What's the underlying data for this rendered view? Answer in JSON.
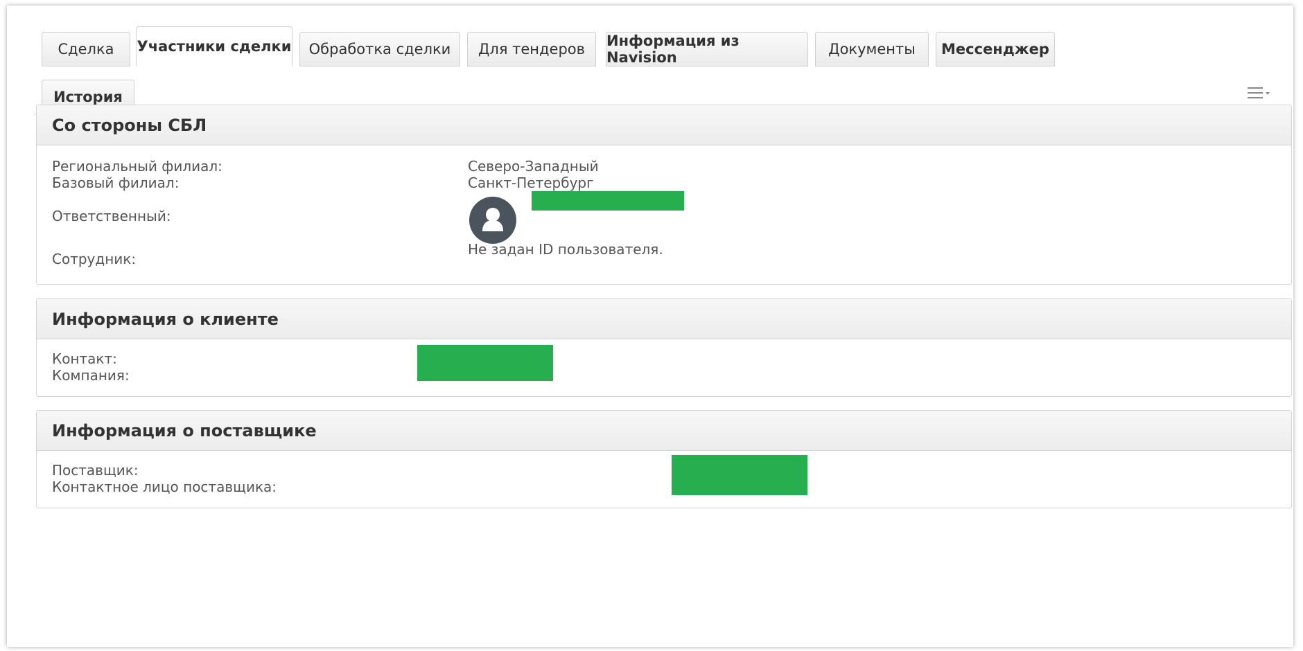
{
  "tabs": [
    {
      "label": "Сделка"
    },
    {
      "label": "Участники сделки"
    },
    {
      "label": "Обработка сделки"
    },
    {
      "label": "Для тендеров"
    },
    {
      "label": "Информация из Navision"
    },
    {
      "label": "Документы"
    },
    {
      "label": "Мессенджер"
    },
    {
      "label": "История"
    }
  ],
  "active_tab": "Участники сделки",
  "sbl": {
    "title": "Со стороны СБЛ",
    "regional_label": "Региональный филиал:",
    "regional_value": "Северо-Западный",
    "base_label": "Базовый филиал:",
    "base_value": "Санкт-Петербург",
    "responsible_label": "Ответственный:",
    "employee_label": "Сотрудник:",
    "employee_value": "Не задан ID пользователя."
  },
  "client": {
    "title": "Информация о клиенте",
    "contact_label": "Контакт:",
    "company_label": "Компания:"
  },
  "supplier": {
    "title": "Информация о поставщике",
    "supplier_label": "Поставщик:",
    "contact_label": "Контактное лицо поставщика:"
  },
  "colors": {
    "redaction": "#27ae4f",
    "avatar": "#4b535c"
  },
  "icons": {
    "menu": "hamburger-menu-icon",
    "avatar": "user-avatar-icon"
  }
}
